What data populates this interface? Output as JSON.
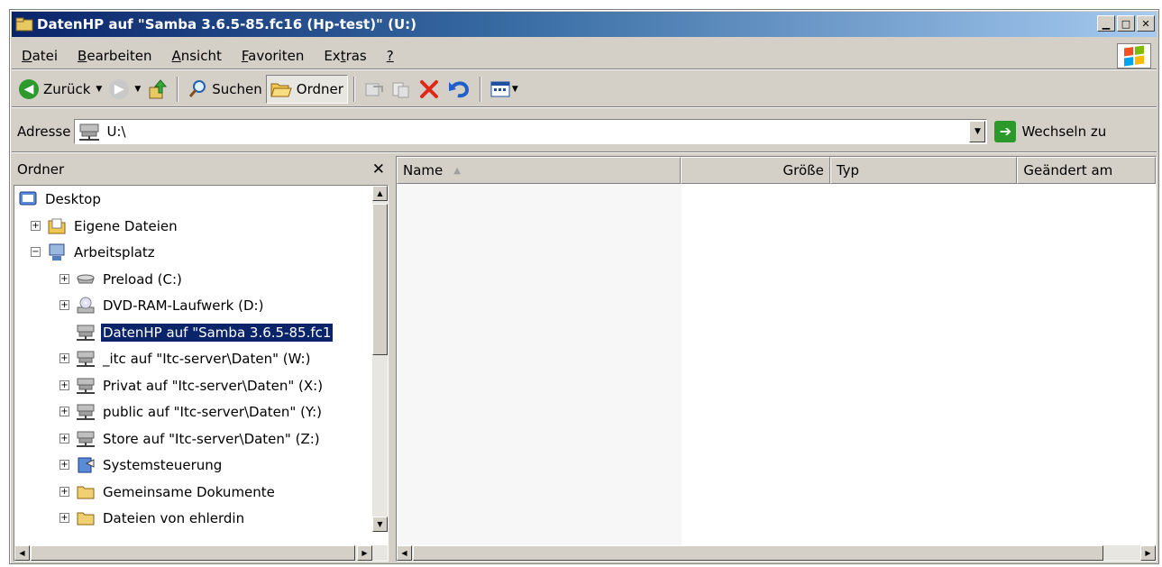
{
  "window": {
    "title": "DatenHP auf \"Samba 3.6.5-85.fc16 (Hp-test)\" (U:)",
    "caption_buttons": [
      "minimize-icon",
      "maximize-icon",
      "close-icon"
    ]
  },
  "menubar": {
    "items": [
      {
        "label": "Datei",
        "accel": "D"
      },
      {
        "label": "Bearbeiten",
        "accel": "B"
      },
      {
        "label": "Ansicht",
        "accel": "A"
      },
      {
        "label": "Favoriten",
        "accel": "F"
      },
      {
        "label": "Extras",
        "accel": "t"
      },
      {
        "label": "?",
        "accel": "?"
      }
    ]
  },
  "toolbar": {
    "back_label": "Zurück",
    "search_label": "Suchen",
    "folders_label": "Ordner",
    "icons": [
      "back-icon",
      "forward-icon",
      "up-icon",
      "search-icon",
      "folders-icon",
      "move-to-icon",
      "copy-to-icon",
      "delete-icon",
      "undo-icon",
      "views-icon"
    ]
  },
  "address": {
    "label": "Adresse",
    "value": "U:\\",
    "go_label": "Wechseln zu"
  },
  "folder_pane": {
    "title": "Ordner",
    "tree": [
      {
        "label": "Desktop",
        "level": 0,
        "expander": "",
        "icon": "desktop-icon"
      },
      {
        "label": "Eigene Dateien",
        "level": 1,
        "expander": "+",
        "icon": "my-documents-icon"
      },
      {
        "label": "Arbeitsplatz",
        "level": 1,
        "expander": "−",
        "icon": "my-computer-icon"
      },
      {
        "label": "Preload (C:)",
        "level": 2,
        "expander": "+",
        "icon": "hard-drive-icon"
      },
      {
        "label": "DVD-RAM-Laufwerk (D:)",
        "level": 2,
        "expander": "+",
        "icon": "dvd-drive-icon"
      },
      {
        "label": "DatenHP auf \"Samba 3.6.5-85.fc1",
        "level": 2,
        "expander": "",
        "icon": "network-drive-icon",
        "selected": true
      },
      {
        "label": "_itc auf \"Itc-server\\Daten\" (W:)",
        "level": 2,
        "expander": "+",
        "icon": "network-drive-icon"
      },
      {
        "label": "Privat auf \"Itc-server\\Daten\" (X:)",
        "level": 2,
        "expander": "+",
        "icon": "network-drive-icon"
      },
      {
        "label": "public auf \"Itc-server\\Daten\" (Y:)",
        "level": 2,
        "expander": "+",
        "icon": "network-drive-icon"
      },
      {
        "label": "Store auf \"Itc-server\\Daten\" (Z:)",
        "level": 2,
        "expander": "+",
        "icon": "network-drive-icon"
      },
      {
        "label": "Systemsteuerung",
        "level": 2,
        "expander": "+",
        "icon": "control-panel-icon"
      },
      {
        "label": "Gemeinsame Dokumente",
        "level": 2,
        "expander": "+",
        "icon": "folder-icon"
      },
      {
        "label": "Dateien von ehlerdin",
        "level": 2,
        "expander": "+",
        "icon": "folder-icon"
      }
    ]
  },
  "list_pane": {
    "columns": [
      {
        "label": "Name",
        "align": "left",
        "sorted": true
      },
      {
        "label": "Größe",
        "align": "right"
      },
      {
        "label": "Typ",
        "align": "left"
      },
      {
        "label": "Geändert am",
        "align": "left"
      }
    ],
    "rows": []
  },
  "colors": {
    "title_start": "#0a246a",
    "title_end": "#a6caf0",
    "face": "#d4d0c8",
    "selection": "#0a246a"
  }
}
